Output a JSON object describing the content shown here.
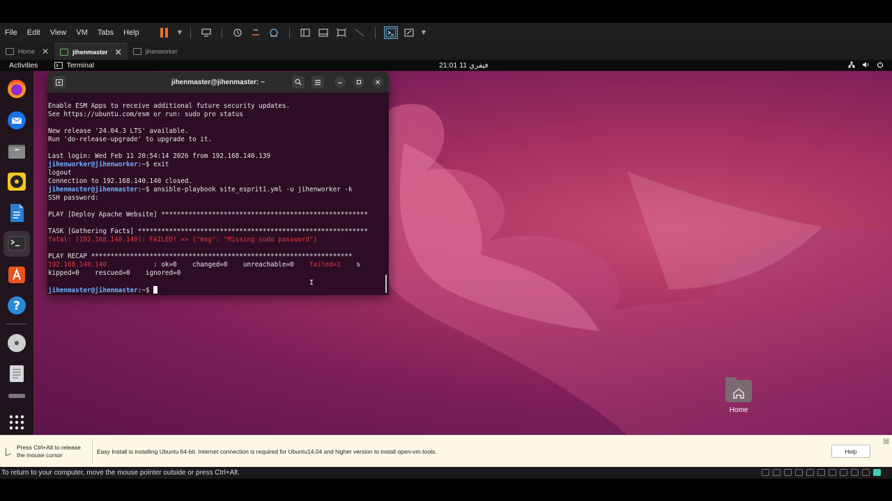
{
  "vm": {
    "menu": [
      "File",
      "Edit",
      "View",
      "VM",
      "Tabs",
      "Help"
    ],
    "tabs": [
      {
        "label": "Home",
        "active": false
      },
      {
        "label": "jihenmaster",
        "active": true
      },
      {
        "label": "jihenworker",
        "active": false
      }
    ]
  },
  "ubuntu": {
    "activities": "Activities",
    "app_name": "Terminal",
    "clock": "21:01  فيفري 11",
    "desktop_home_label": "Home"
  },
  "terminal": {
    "title": "jihenmaster@jihenmaster: ~",
    "lines": [
      {
        "kind": "text",
        "text": "Enable ESM Apps to receive additional future security updates."
      },
      {
        "kind": "text",
        "text": "See https://ubuntu.com/esm or run: sudo pro status"
      },
      {
        "kind": "blank",
        "text": ""
      },
      {
        "kind": "text",
        "text": "New release '24.04.3 LTS' available."
      },
      {
        "kind": "text",
        "text": "Run 'do-release-upgrade' to upgrade to it."
      },
      {
        "kind": "blank",
        "text": ""
      },
      {
        "kind": "text",
        "text": "Last login: Wed Feb 11 20:54:14 2026 from 192.168.140.139"
      },
      {
        "kind": "prompt",
        "prompt": "jihenworker@jihenworker",
        "cmd": ":~$ exit"
      },
      {
        "kind": "text",
        "text": "logout"
      },
      {
        "kind": "text",
        "text": "Connection to 192.168.140.140 closed."
      },
      {
        "kind": "prompt",
        "prompt": "jihenmaster@jihenmaster",
        "cmd": ":~$ ansible-playbook site_esprit1.yml -u jihenworker -k"
      },
      {
        "kind": "text",
        "text": "SSH password:"
      },
      {
        "kind": "blank",
        "text": ""
      },
      {
        "kind": "text",
        "text": "PLAY [Deploy Apache Website] *****************************************************"
      },
      {
        "kind": "blank",
        "text": ""
      },
      {
        "kind": "text",
        "text": "TASK [Gathering Facts] ***********************************************************"
      },
      {
        "kind": "error",
        "text": "fatal: [192.168.140.140]: FAILED! => {\"msg\": \"Missing sudo password\"}"
      },
      {
        "kind": "blank",
        "text": ""
      },
      {
        "kind": "text",
        "text": "PLAY RECAP *******************************************************************"
      },
      {
        "kind": "recap",
        "host": "192.168.140.140",
        "mid": "            : ok=0    changed=0    unreachable=0    ",
        "failed": "failed=1",
        "tail": "    s"
      },
      {
        "kind": "text",
        "text": "kipped=0    rescued=0    ignored=0"
      },
      {
        "kind": "blank",
        "text": ""
      },
      {
        "kind": "cursor",
        "prompt": "jihenmaster@jihenmaster",
        "cmd": ":~$ "
      }
    ]
  },
  "notification": {
    "cursor_hint": "Press Ctrl+Alt to release the mouse cursor",
    "message": "Easy Install is installing Ubuntu 64-bit. Internet connection is required for Ubuntu14.04 and higher version to install open-vm-tools.",
    "help_label": "Help"
  },
  "status_text": "To return to your computer, move the mouse pointer outside or press Ctrl+Alt."
}
